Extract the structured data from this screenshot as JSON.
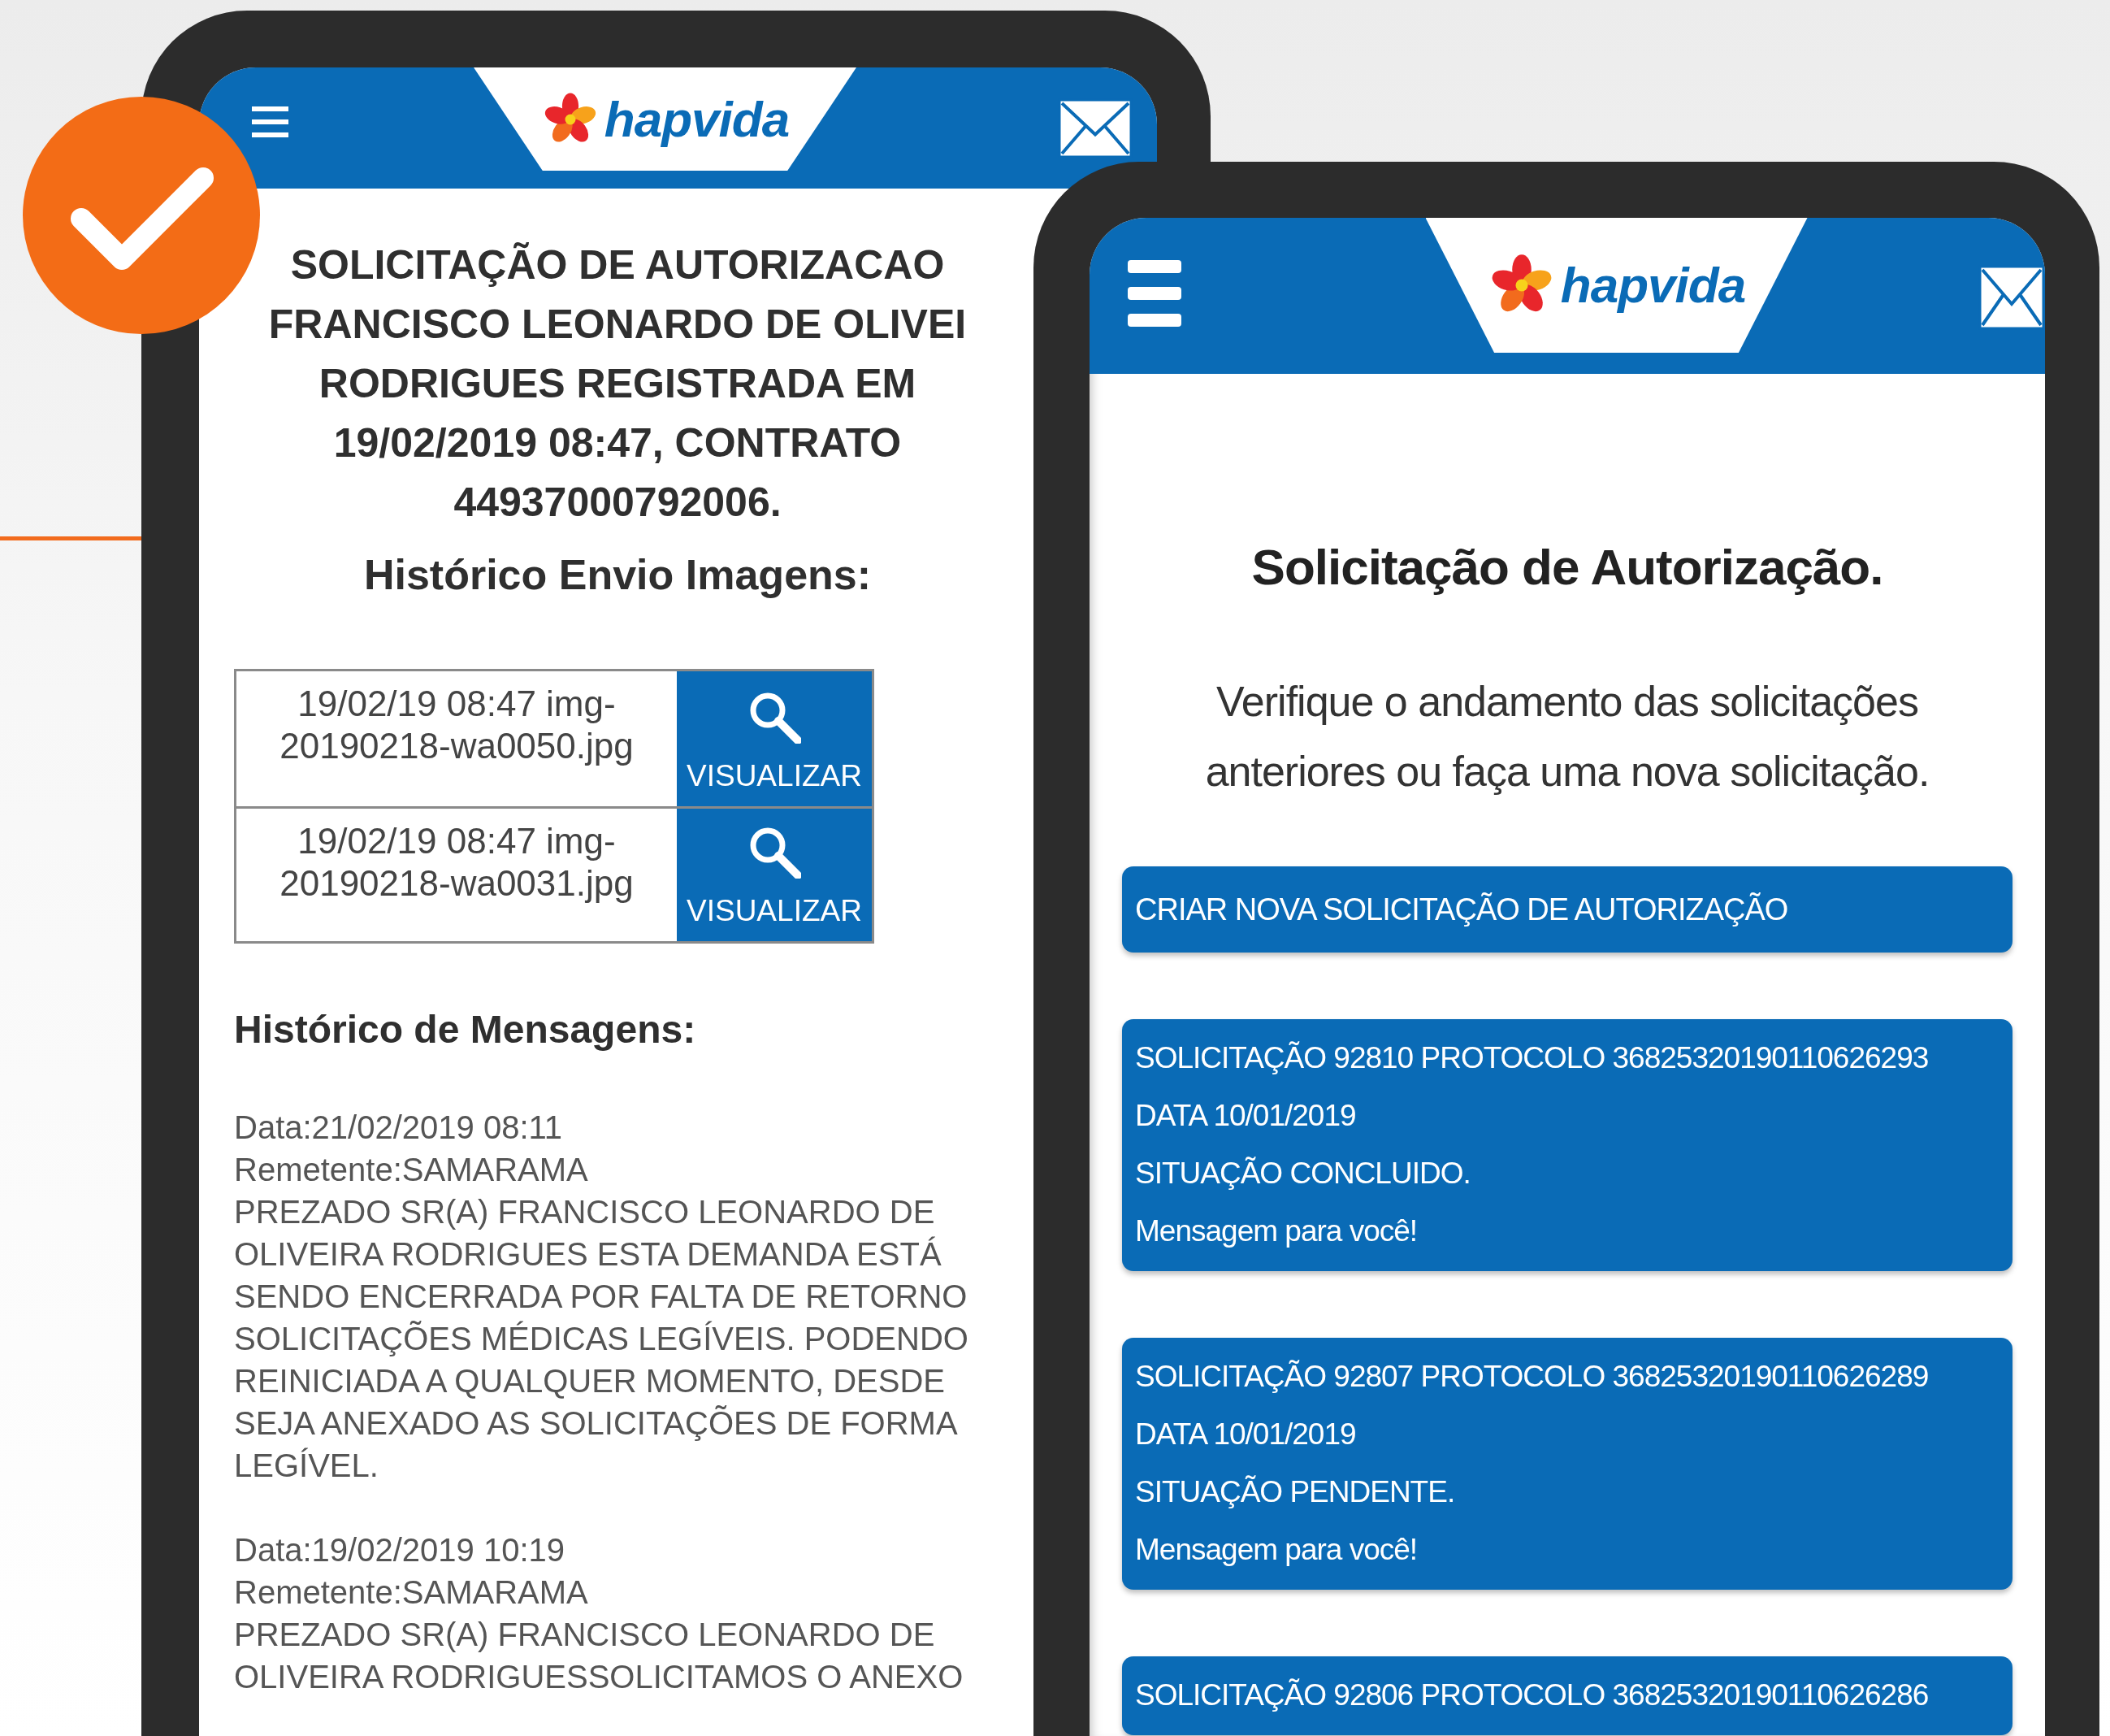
{
  "left_screen": {
    "logo": "hapvida",
    "title_lines": [
      "SOLICITAÇÃO DE AUTORIZACAO",
      "FRANCISCO LEONARDO DE OLIVEI",
      "RODRIGUES REGISTRADA EM",
      "19/02/2019 08:47, CONTRATO",
      "44937000792006."
    ],
    "images_heading": "Histórico Envio Imagens:",
    "images": [
      {
        "file": "19/02/19 08:47 img-20190218-wa0050.jpg",
        "button": "VISUALIZAR"
      },
      {
        "file": "19/02/19 08:47 img-20190218-wa0031.jpg",
        "button": "VISUALIZAR"
      }
    ],
    "messages_heading": "Histórico de Mensagens:",
    "messages": [
      {
        "lines": [
          "Data:21/02/2019 08:11",
          "Remetente:SAMARAMA",
          "PREZADO SR(A) FRANCISCO LEONARDO DE",
          "OLIVEIRA RODRIGUES ESTA DEMANDA ESTÁ",
          "SENDO ENCERRADA POR FALTA DE RETORNO",
          "SOLICITAÇÕES MÉDICAS LEGÍVEIS. PODENDO",
          "REINICIADA A QUALQUER MOMENTO, DESDE",
          "SEJA ANEXADO AS SOLICITAÇÕES DE FORMA",
          "LEGÍVEL."
        ]
      },
      {
        "lines": [
          "Data:19/02/2019 10:19",
          "Remetente:SAMARAMA",
          "PREZADO SR(A) FRANCISCO LEONARDO DE",
          "OLIVEIRA RODRIGUESSOLICITAMOS O ANEXO"
        ]
      }
    ]
  },
  "right_screen": {
    "logo": "hapvida",
    "title": "Solicitação de Autorização.",
    "intro_lines": [
      "Verifique o andamento das solicitações",
      "anteriores ou faça uma nova solicitação."
    ],
    "new_button": "CRIAR NOVA SOLICITAÇÃO DE AUTORIZAÇÃO",
    "requests": [
      {
        "lines": [
          "SOLICITAÇÃO 92810 PROTOCOLO 36825320190110626293",
          "DATA 10/01/2019",
          "SITUAÇÃO CONCLUIDO."
        ],
        "link": "Mensagem para você!"
      },
      {
        "lines": [
          "SOLICITAÇÃO 92807 PROTOCOLO 36825320190110626289",
          "DATA 10/01/2019",
          "SITUAÇÃO PENDENTE."
        ],
        "link": "Mensagem para você!"
      },
      {
        "lines": [
          "SOLICITAÇÃO 92806 PROTOCOLO 36825320190110626286"
        ]
      }
    ]
  }
}
